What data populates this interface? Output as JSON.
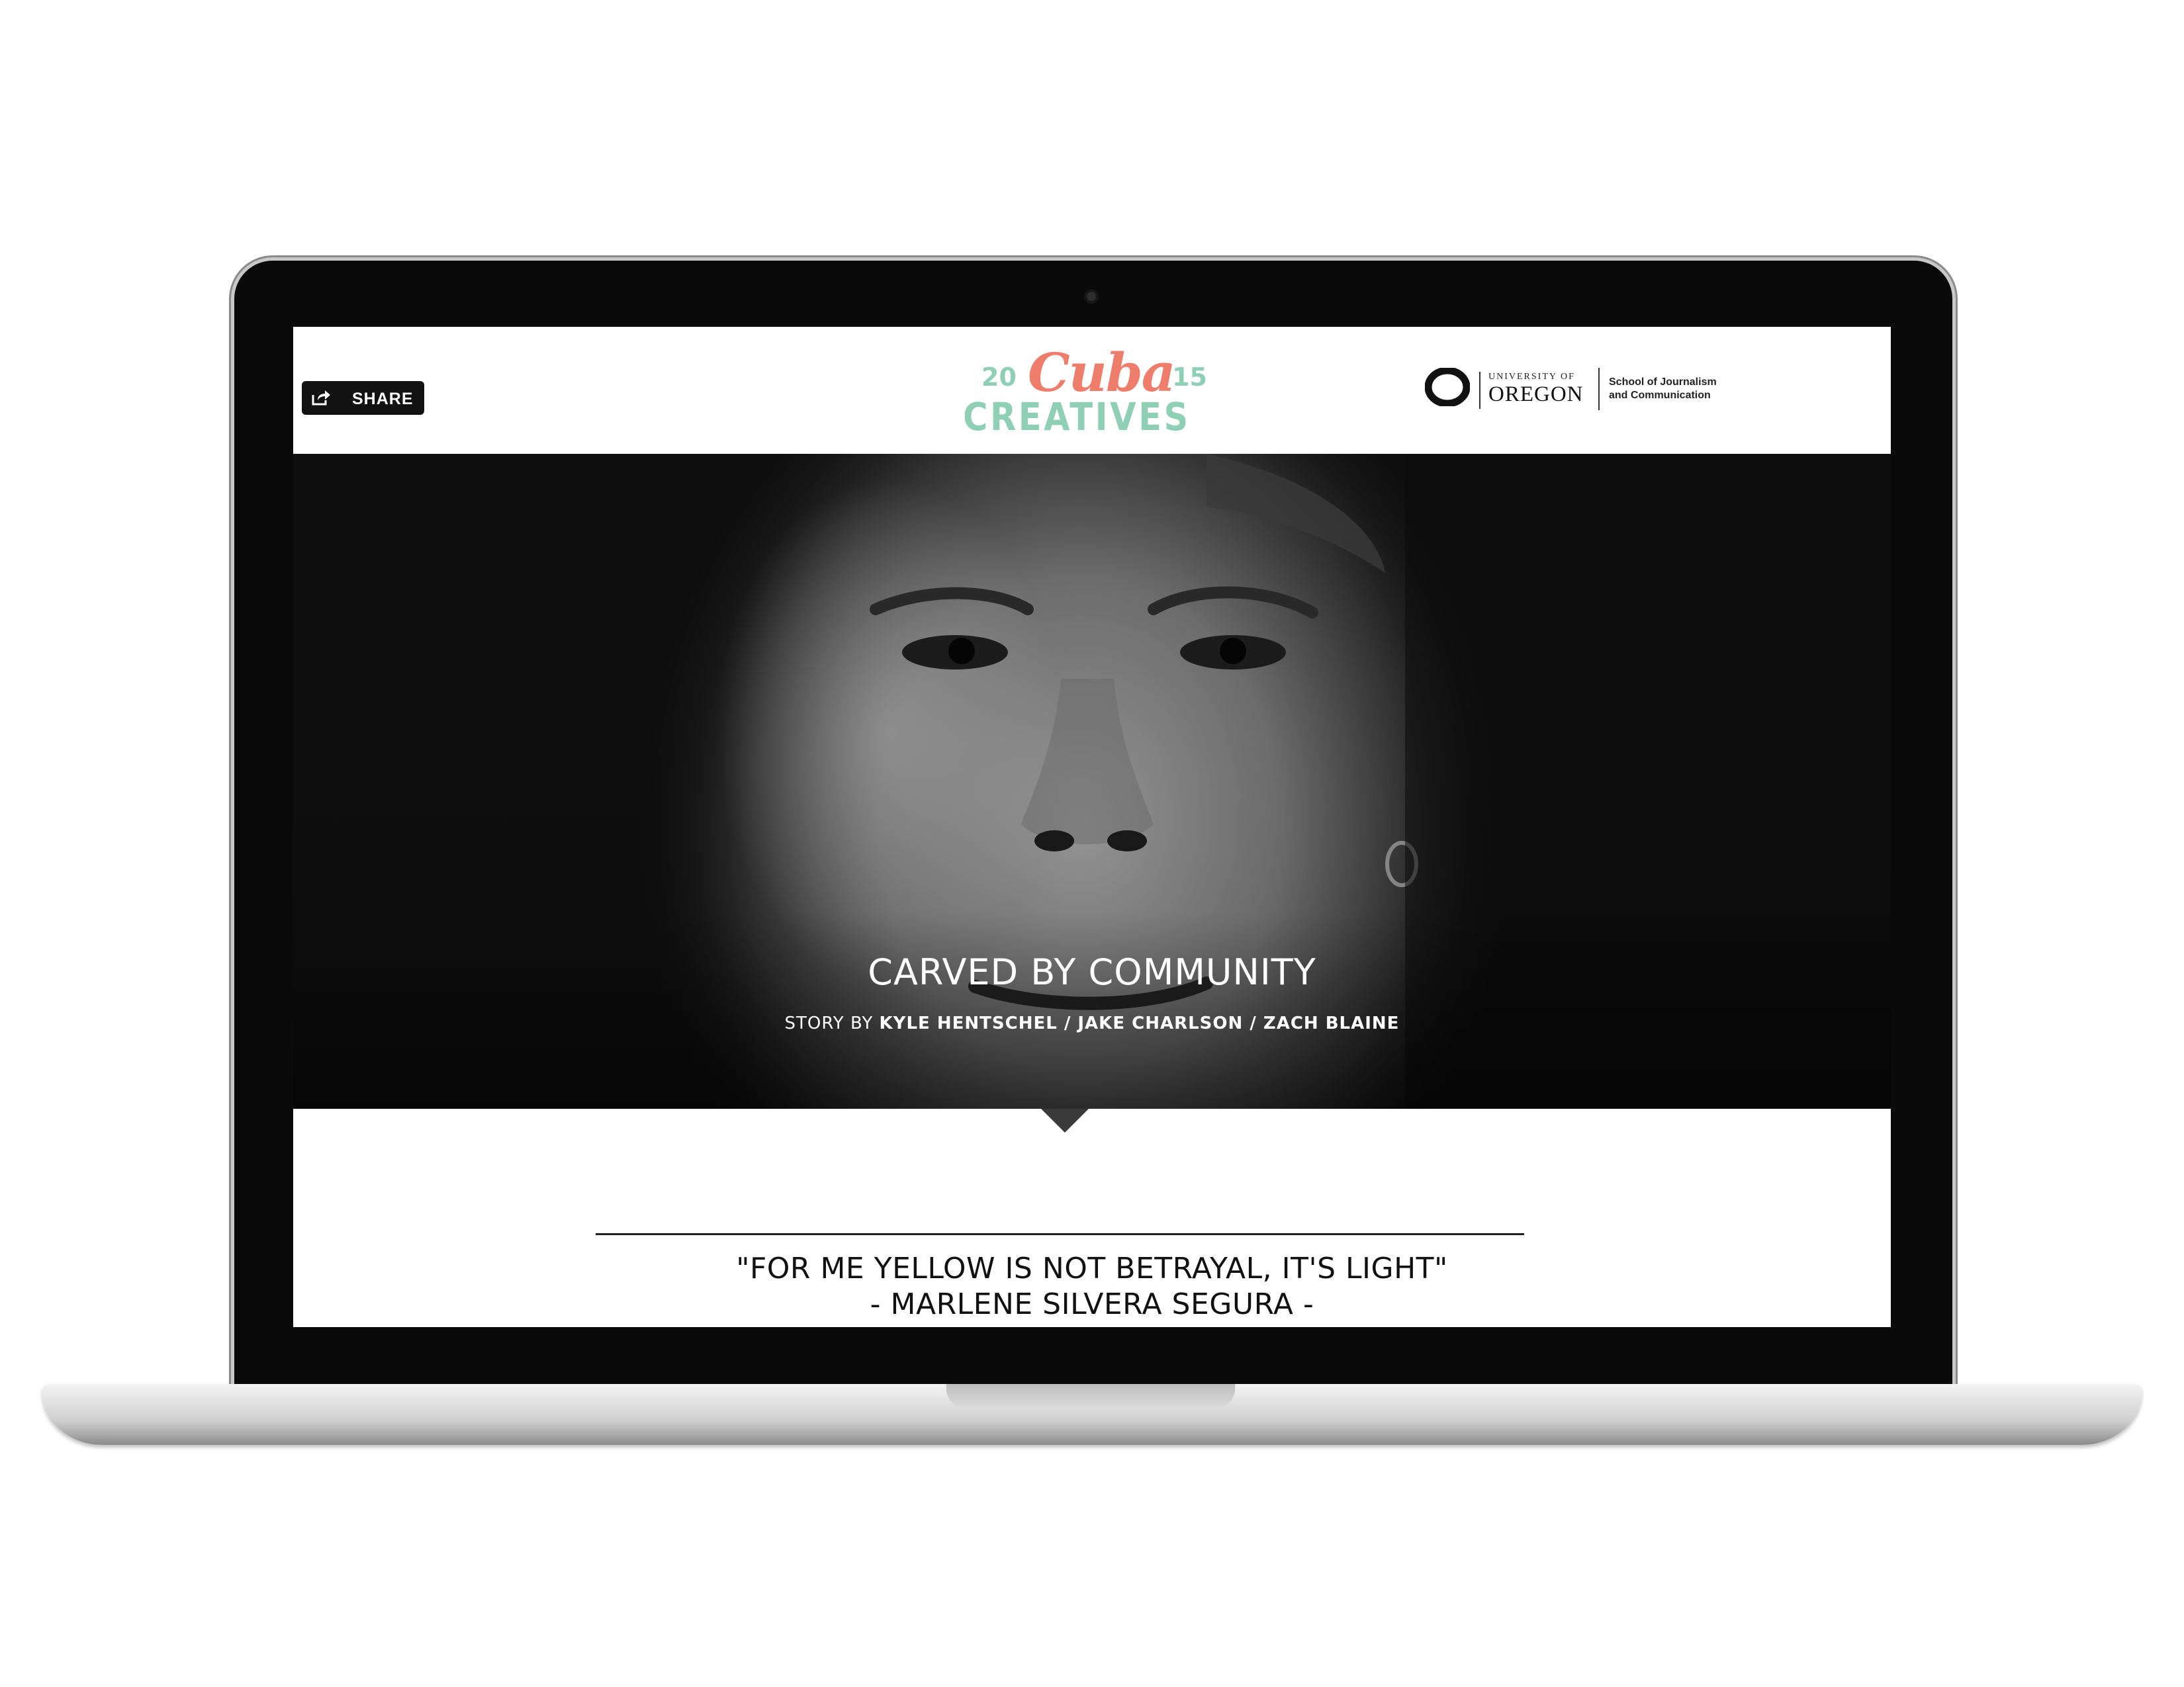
{
  "header": {
    "share_label": "SHARE",
    "logo": {
      "year_left": "20",
      "wordmark": "Cuba",
      "year_right": "15",
      "subtitle": "CREATIVES",
      "colors": {
        "mint": "#8fcfb6",
        "coral": "#ef7d6b"
      }
    },
    "university": {
      "line1": "UNIVERSITY OF",
      "line2": "OREGON",
      "school_line1": "School of Journalism",
      "school_line2": "and Communication"
    }
  },
  "hero": {
    "title": "CARVED BY COMMUNITY",
    "byline_prefix": "STORY BY",
    "byline_authors": "KYLE HENTSCHEL / JAKE CHARLSON / ZACH BLAINE"
  },
  "article": {
    "quote": "\"FOR ME YELLOW IS NOT BETRAYAL, IT'S LIGHT\"",
    "attribution": "- MARLENE SILVERA SEGURA -"
  },
  "icons": {
    "share": "share-icon",
    "university_mark": "oregon-o-icon"
  }
}
